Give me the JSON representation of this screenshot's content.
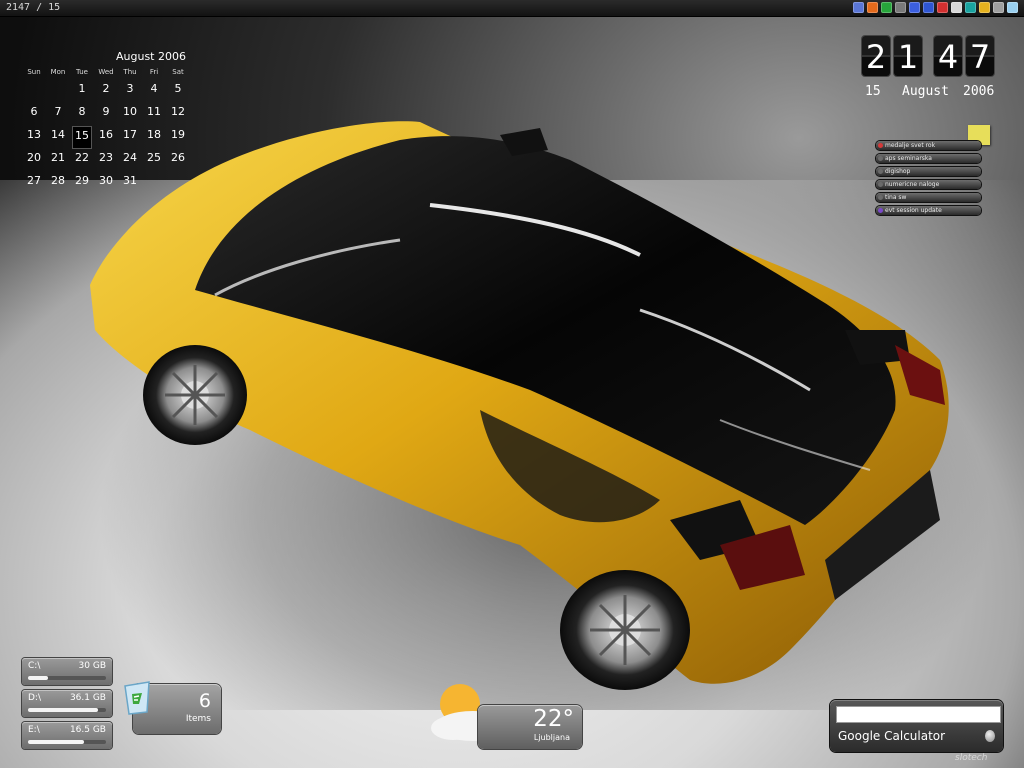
{
  "topbar": {
    "title": "2147 / 15",
    "tray_icons": [
      "save-icon",
      "firefox-icon",
      "skype-icon",
      "shield-icon",
      "bluetooth-icon",
      "globe-icon",
      "cube-icon",
      "chat-icon",
      "network-icon",
      "power-icon",
      "wrench-icon",
      "speaker-icon"
    ],
    "tray_colors": [
      "#5a76d6",
      "#e46a1c",
      "#27a53b",
      "#7a7a7a",
      "#3b5fe0",
      "#2f56d2",
      "#d33030",
      "#d8d8d8",
      "#1aa3a0",
      "#e6b21f",
      "#a0a0a0",
      "#9ad0f0"
    ]
  },
  "calendar": {
    "title": "August 2006",
    "weekdays": [
      "Sun",
      "Mon",
      "Tue",
      "Wed",
      "Thu",
      "Fri",
      "Sat"
    ],
    "days": [
      "",
      "",
      "1",
      "2",
      "3",
      "4",
      "5",
      "6",
      "7",
      "8",
      "9",
      "10",
      "11",
      "12",
      "13",
      "14",
      "15",
      "16",
      "17",
      "18",
      "19",
      "20",
      "21",
      "22",
      "23",
      "24",
      "25",
      "26",
      "27",
      "28",
      "29",
      "30",
      "31"
    ],
    "today": "15"
  },
  "clock": {
    "digits": [
      "2",
      "1",
      "4",
      "7"
    ],
    "day": "15",
    "month": "August",
    "year": "2006"
  },
  "notes": {
    "items": [
      {
        "label": "medalje svet rok",
        "color": "#d43a3a"
      },
      {
        "label": "aps seminarska",
        "color": "#6a6a6a"
      },
      {
        "label": "digishop",
        "color": "#6a6a6a"
      },
      {
        "label": "numericne naloge",
        "color": "#6a6a6a"
      },
      {
        "label": "tina sw",
        "color": "#6a6a6a"
      },
      {
        "label": "evt session update",
        "color": "#7a49c9"
      }
    ]
  },
  "drives": [
    {
      "label": "C:\\",
      "capacity": "30 GB",
      "used_fraction": 0.25
    },
    {
      "label": "D:\\",
      "capacity": "36.1 GB",
      "used_fraction": 0.9
    },
    {
      "label": "E:\\",
      "capacity": "16.5 GB",
      "used_fraction": 0.72
    }
  ],
  "recycle_bin": {
    "count": "6",
    "label": "Items"
  },
  "weather": {
    "temperature": "22°",
    "city": "Ljubljana"
  },
  "google_calculator": {
    "title": "Google Calculator",
    "value": ""
  },
  "watermark": "slotech"
}
